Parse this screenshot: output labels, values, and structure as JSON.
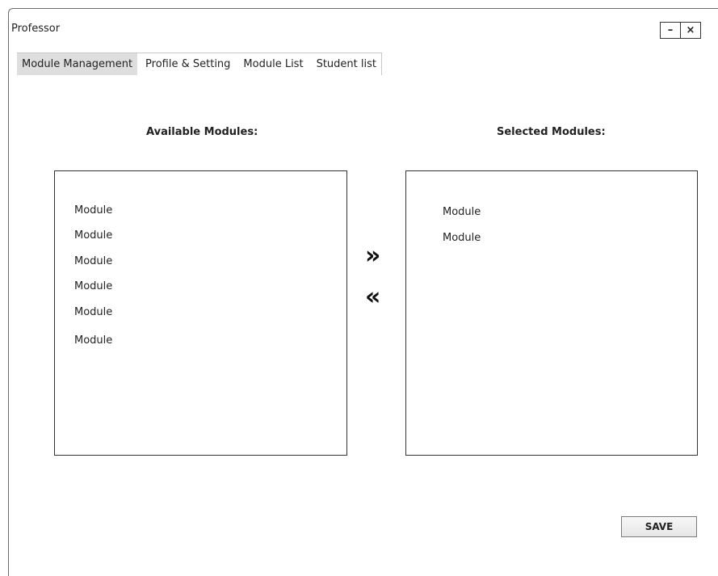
{
  "window": {
    "title": "Professor",
    "minimize_label": "–",
    "close_label": "×"
  },
  "tabs": [
    {
      "label": "Module Management",
      "active": true
    },
    {
      "label": "Profile & Setting",
      "active": false
    },
    {
      "label": "Module List",
      "active": false
    },
    {
      "label": "Student list",
      "active": false
    }
  ],
  "available": {
    "heading": "Available Modules:",
    "items": [
      "Module",
      "Module",
      "Module",
      "Module",
      "Module",
      "Module"
    ]
  },
  "selected": {
    "heading": "Selected Modules:",
    "items": [
      "Module",
      "Module"
    ]
  },
  "transfer": {
    "add_symbol": "»",
    "remove_symbol": "«"
  },
  "actions": {
    "save_label": "SAVE"
  }
}
